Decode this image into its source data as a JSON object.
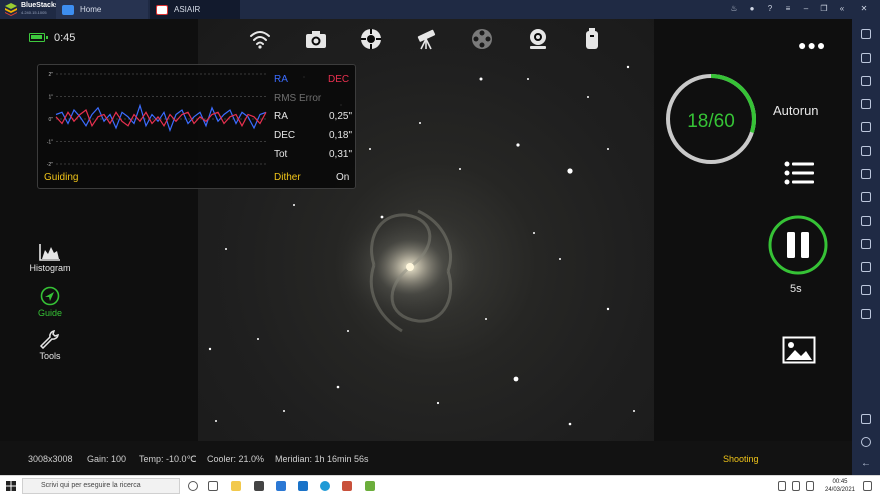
{
  "titlebar": {
    "app_name": "BlueStacks",
    "app_version": "4.240.15.1005",
    "tabs": [
      {
        "label": "Home"
      },
      {
        "label": "ASIAIR"
      }
    ]
  },
  "status": {
    "time": "0:45"
  },
  "guide_graph": {
    "y_ticks": [
      "2\"",
      "1\"",
      "0\"",
      "-1\"",
      "-2\""
    ],
    "ra_label": "RA",
    "dec_label": "DEC",
    "rms_title": "RMS Error",
    "rows": [
      {
        "label": "RA",
        "value": "0,25\""
      },
      {
        "label": "DEC",
        "value": "0,18\""
      },
      {
        "label": "Tot",
        "value": "0,31\""
      }
    ],
    "mode_label": "Guiding",
    "dither_label": "Dither",
    "dither_value": "On",
    "colors": {
      "ra": "#3b6cff",
      "dec": "#e8304f"
    }
  },
  "side_menu": [
    {
      "label": "Histogram",
      "icon": "histogram-icon"
    },
    {
      "label": "Guide",
      "icon": "guide-icon"
    },
    {
      "label": "Tools",
      "icon": "wrench-icon"
    }
  ],
  "top_toolbar": [
    "wifi-icon",
    "camera-icon",
    "focuser-icon",
    "telescope-icon",
    "filter-wheel-icon",
    "guide-camera-icon",
    "usb-device-icon"
  ],
  "right_panel": {
    "progress_text": "18/60",
    "progress": {
      "done": 18,
      "total": 60
    },
    "autorun_label": "Autorun",
    "exposure": "5s",
    "accent_color": "#36c236"
  },
  "statusbar": {
    "resolution": "3008x3008",
    "gain": "Gain: 100",
    "temp": "Temp: -10.0℃",
    "cooler": "Cooler: 21.0%",
    "meridian": "Meridian: 1h 16min 56s",
    "state": "Shooting"
  },
  "taskbar": {
    "search_placeholder": "Scrivi qui per eseguire la ricerca",
    "clock_time": "00:45",
    "clock_date": "24/03/2021"
  }
}
